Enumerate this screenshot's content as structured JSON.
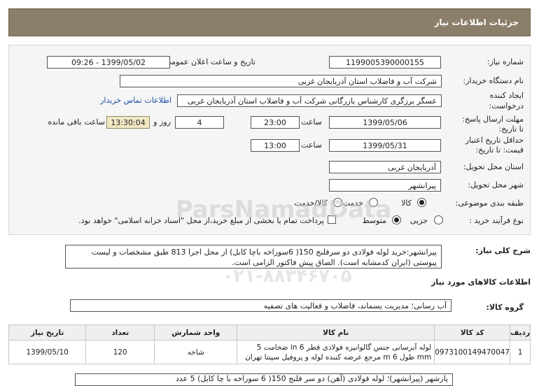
{
  "header": {
    "title": "جزئیات اطلاعات نیاز"
  },
  "fields": {
    "need_number_label": "شماره نیاز:",
    "need_number": "1199005390000155",
    "announce_label": "تاریخ و ساعت اعلان عمومی:",
    "announce_value": "1399/05/02 - 09:26",
    "buyer_label": "نام دستگاه خریدار:",
    "buyer_value": "شرکت آب و فاضلاب استان آذربایجان غربی",
    "creator_label_1": "ایجاد کننده",
    "creator_label_2": "درخواست:",
    "creator_value": "عسگر  برزگری کارشناس بازرگانی شرکت آب و فاضلاب استان آذربایجان غربی",
    "contact_link": "اطلاعات تماس خریدار",
    "reply_label_1": "مهلت ارسال پاسخ:",
    "reply_label_2": "تا تاریخ:",
    "reply_date": "1399/05/06",
    "time_label": "ساعت",
    "reply_time": "23:00",
    "days_value": "4",
    "days_label": "روز و",
    "remaining_time": "13:30:04",
    "remaining_label": "ساعت باقی مانده",
    "validity_label_1": "حداقل تاریخ اعتبار",
    "validity_label_2": "قیمت: تا تاریخ:",
    "validity_date": "1399/05/31",
    "validity_time": "13:00",
    "province_label": "استان محل تحویل:",
    "province_value": "آذربایجان غربی",
    "city_label": "شهر محل تحویل:",
    "city_value": "پیرانشهر",
    "category_label": "طبقه بندی موضوعی:",
    "category_options": [
      "کالا",
      "خدمت",
      "کالا/خدمت"
    ],
    "process_label": "نوع فرآیند خرید :",
    "process_options": [
      "جزیی",
      "متوسط"
    ],
    "payment_note": "پرداخت تمام یا بخشی از مبلغ خرید،از محل \"اسناد خزانه اسلامی\" خواهد بود."
  },
  "description": {
    "label": "شرح کلی نیاز:",
    "text": "پیرانشهر:خرید لوله فولادی دو سرفلنج 150( 6سوراخه باچا کابل) از محل اجرا 813 طبق مشخصات و لیست پیوستی (ایران کدمشابه است). الصاق پیش فاکتور الزامی است."
  },
  "goods": {
    "section_title": "اطلاعات کالاهای مورد نیاز",
    "group_label": "گروه کالا:",
    "group_value": "آب رسانی؛ مدیریت پسماند، فاضلاب و فعالیت های تصفیه",
    "columns": [
      "ردیف",
      "کد کالا",
      "نام کالا",
      "واحد شمارش",
      "تعداد",
      "تاریخ نیاز"
    ],
    "rows": [
      {
        "index": "1",
        "code": "0973100149470047",
        "name": "لوله آبرسانی جنس گالوانیزه فولادی قطر 6 in ضخامت 5 mm طول 6 m مرجع عرضه کننده لوله و پروفیل سپنتا تهران",
        "unit": "شاخه",
        "qty": "120",
        "date": "1399/05/10"
      }
    ],
    "bottom_note": "پارشهر (پیرانشهر)؛ لوله فولادی (آهن) دو سر فلنج 150( 6 سوراخه با چا کابل) 5 عدد"
  },
  "watermark": {
    "brand": "ParsNamadData",
    "phone": "۰۲۱-۸۸۳۴۶۷۰۵"
  }
}
